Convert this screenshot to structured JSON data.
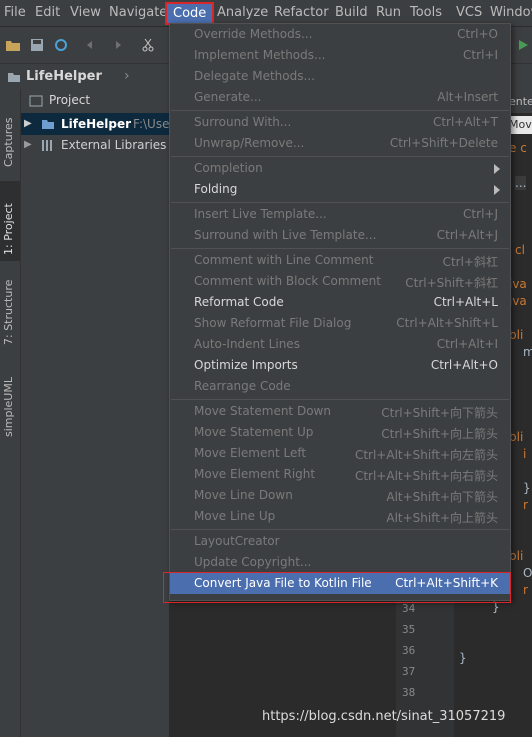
{
  "menubar": {
    "items": [
      {
        "label": "File"
      },
      {
        "label": "Edit"
      },
      {
        "label": "View"
      },
      {
        "label": "Navigate"
      },
      {
        "label": "Code"
      },
      {
        "label": "Analyze"
      },
      {
        "label": "Refactor"
      },
      {
        "label": "Build"
      },
      {
        "label": "Run"
      },
      {
        "label": "Tools"
      },
      {
        "label": "VCS"
      },
      {
        "label": "Window"
      }
    ]
  },
  "navbar": {
    "project": "LifeHelper"
  },
  "left_tabs": [
    "Captures",
    "1: Project",
    "7: Structure",
    "simpleUML"
  ],
  "project_panel": {
    "header": "Project",
    "tree": [
      {
        "label": "LifeHelper",
        "path": "F:\\Use"
      },
      {
        "label": "External Libraries"
      }
    ]
  },
  "editor": {
    "tab_fragment": "enter",
    "code_fragments": [
      "Mov",
      "e c",
      "...",
      "cl",
      "iva",
      "iva",
      "bli",
      "m",
      "bli",
      "i",
      "}",
      "r",
      "bli",
      "O",
      "r",
      "}",
      "}"
    ],
    "line_numbers": [
      "34",
      "35",
      "36",
      "37",
      "38"
    ]
  },
  "code_menu": {
    "items": [
      {
        "label": "Override Methods...",
        "shortcut": "Ctrl+O",
        "enabled": false
      },
      {
        "label": "Implement Methods...",
        "shortcut": "Ctrl+I",
        "enabled": false
      },
      {
        "label": "Delegate Methods...",
        "shortcut": "",
        "enabled": false
      },
      {
        "label": "Generate...",
        "shortcut": "Alt+Insert",
        "enabled": false
      },
      {
        "label": "Surround With...",
        "shortcut": "Ctrl+Alt+T",
        "enabled": false
      },
      {
        "label": "Unwrap/Remove...",
        "shortcut": "Ctrl+Shift+Delete",
        "enabled": false
      },
      {
        "label": "Completion",
        "shortcut": "",
        "enabled": false,
        "submenu": true
      },
      {
        "label": "Folding",
        "shortcut": "",
        "enabled": true,
        "submenu": true
      },
      {
        "label": "Insert Live Template...",
        "shortcut": "Ctrl+J",
        "enabled": false
      },
      {
        "label": "Surround with Live Template...",
        "shortcut": "Ctrl+Alt+J",
        "enabled": false
      },
      {
        "label": "Comment with Line Comment",
        "shortcut": "Ctrl+斜杠",
        "enabled": false
      },
      {
        "label": "Comment with Block Comment",
        "shortcut": "Ctrl+Shift+斜杠",
        "enabled": false
      },
      {
        "label": "Reformat Code",
        "shortcut": "Ctrl+Alt+L",
        "enabled": true
      },
      {
        "label": "Show Reformat File Dialog",
        "shortcut": "Ctrl+Alt+Shift+L",
        "enabled": false
      },
      {
        "label": "Auto-Indent Lines",
        "shortcut": "Ctrl+Alt+I",
        "enabled": false
      },
      {
        "label": "Optimize Imports",
        "shortcut": "Ctrl+Alt+O",
        "enabled": true
      },
      {
        "label": "Rearrange Code",
        "shortcut": "",
        "enabled": false
      },
      {
        "label": "Move Statement Down",
        "shortcut": "Ctrl+Shift+向下箭头",
        "enabled": false
      },
      {
        "label": "Move Statement Up",
        "shortcut": "Ctrl+Shift+向上箭头",
        "enabled": false
      },
      {
        "label": "Move Element Left",
        "shortcut": "Ctrl+Alt+Shift+向左箭头",
        "enabled": false
      },
      {
        "label": "Move Element Right",
        "shortcut": "Ctrl+Alt+Shift+向右箭头",
        "enabled": false
      },
      {
        "label": "Move Line Down",
        "shortcut": "Alt+Shift+向下箭头",
        "enabled": false
      },
      {
        "label": "Move Line Up",
        "shortcut": "Alt+Shift+向上箭头",
        "enabled": false
      },
      {
        "label": "LayoutCreator",
        "shortcut": "",
        "enabled": false
      },
      {
        "label": "Update Copyright...",
        "shortcut": "",
        "enabled": false
      },
      {
        "label": "Convert Java File to Kotlin File",
        "shortcut": "Ctrl+Alt+Shift+K",
        "enabled": true,
        "selected": true
      }
    ]
  },
  "watermark": "https://blog.csdn.net/sinat_31057219",
  "colors": {
    "selection": "#4b6eaf",
    "highlight_box": "#d9262b",
    "panel": "#3c3f41",
    "editor": "#2b2b2b"
  }
}
